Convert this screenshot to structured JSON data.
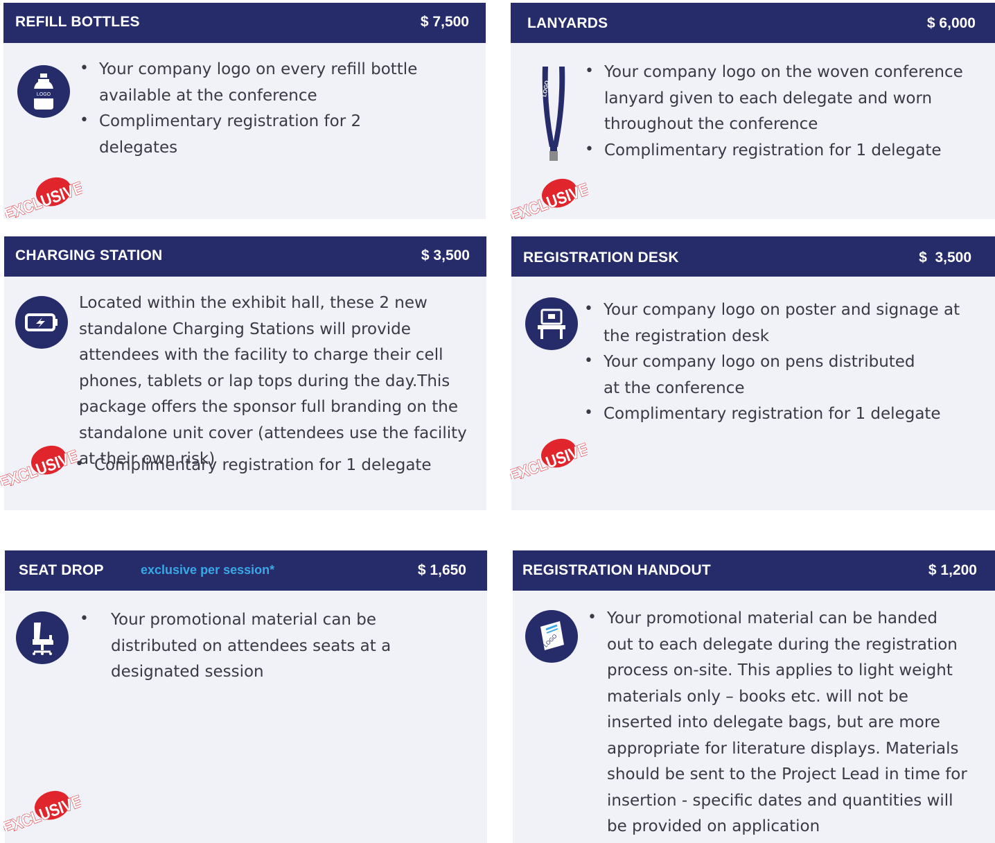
{
  "stamp_text": "EXCLUSIVE",
  "colors": {
    "header": "#262b6a",
    "card": "#f1f1f8",
    "stamp": "#e1252d",
    "subtitle": "#3aa8e6"
  },
  "cards": [
    {
      "title": "REFILL BOTTLES",
      "price": "$ 7,500",
      "icon": "bottle-icon",
      "icon_text": "LOGO",
      "bullets": [
        "Your company logo on every refill bottle available at the conference",
        "Complimentary registration for 2 delegates"
      ]
    },
    {
      "title": "LANYARDS",
      "price": "$ 6,000",
      "icon": "lanyard-icon",
      "icon_text": "LOGO",
      "bullets": [
        "Your company logo on the woven conference lanyard given to each delegate and worn throughout the conference",
        "Complimentary registration for 1 delegate"
      ]
    },
    {
      "title": "CHARGING STATION",
      "price": "$ 3,500",
      "icon": "battery-charging-icon",
      "description": "Located within the exhibit hall, these 2 new standalone Charging Stations will provide attendees with the facility to charge their cell phones, tablets or lap tops during the day.This package offers the sponsor full branding on the standalone unit cover (attendees use the facility at their own risk)",
      "bullets": [
        "Complimentary registration for 1 delegate"
      ]
    },
    {
      "title": "REGISTRATION DESK",
      "price": "$  3,500",
      "icon": "registration-desk-icon",
      "bullets": [
        "Your company logo on poster and signage at the registration desk",
        "Your company logo on pens distributed at the conference",
        "Complimentary registration for 1 delegate"
      ]
    },
    {
      "title": "SEAT DROP",
      "subtitle": "exclusive per session*",
      "price": "$ 1,650",
      "icon": "office-chair-icon",
      "bullets": [
        "Your promotional material can be distributed on attendees seats at a designated session"
      ]
    },
    {
      "title": "REGISTRATION HANDOUT",
      "price": "$ 1,200",
      "icon": "handout-bag-icon",
      "icon_text": "LOGO",
      "bullets": [
        "Your promotional material can be handed out to each delegate during the registration process on-site. This applies to light weight materials only – books etc. will not be inserted into delegate bags, but are more appropriate for literature displays. Materials should be sent to the Project Lead in time for insertion - specific dates and quantities will be provided on application"
      ]
    }
  ]
}
